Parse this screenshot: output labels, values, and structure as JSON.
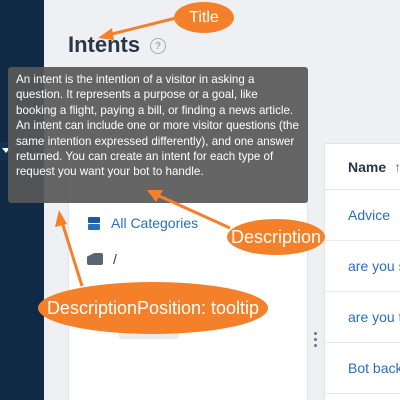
{
  "page": {
    "title": "Intents"
  },
  "tooltip": {
    "text": "An intent is the intention of a visitor in asking a question. It represents a purpose or a goal, like booking a flight, paying a bill, or finding a news article. An intent can include one or more visitor questions (the same intention expressed differently), and one answer returned. You can create an intent for each type of request you want your bot to handle."
  },
  "categories": {
    "items": [
      {
        "label": "All Categories"
      },
      {
        "label": "/"
      }
    ]
  },
  "table": {
    "header": {
      "name": "Name",
      "sort_glyph": "↑"
    },
    "rows": [
      {
        "name": "Advice"
      },
      {
        "name": "are you s"
      },
      {
        "name": "are you t"
      },
      {
        "name": "Bot back"
      }
    ]
  },
  "annotations": {
    "title": "Title",
    "description": "Description",
    "description_position": "DescriptionPosition: tooltip"
  },
  "colors": {
    "sidebar": "#0f2a44",
    "link": "#2a6fb8",
    "callout": "#f5802a",
    "tooltip_bg": "#585858"
  }
}
